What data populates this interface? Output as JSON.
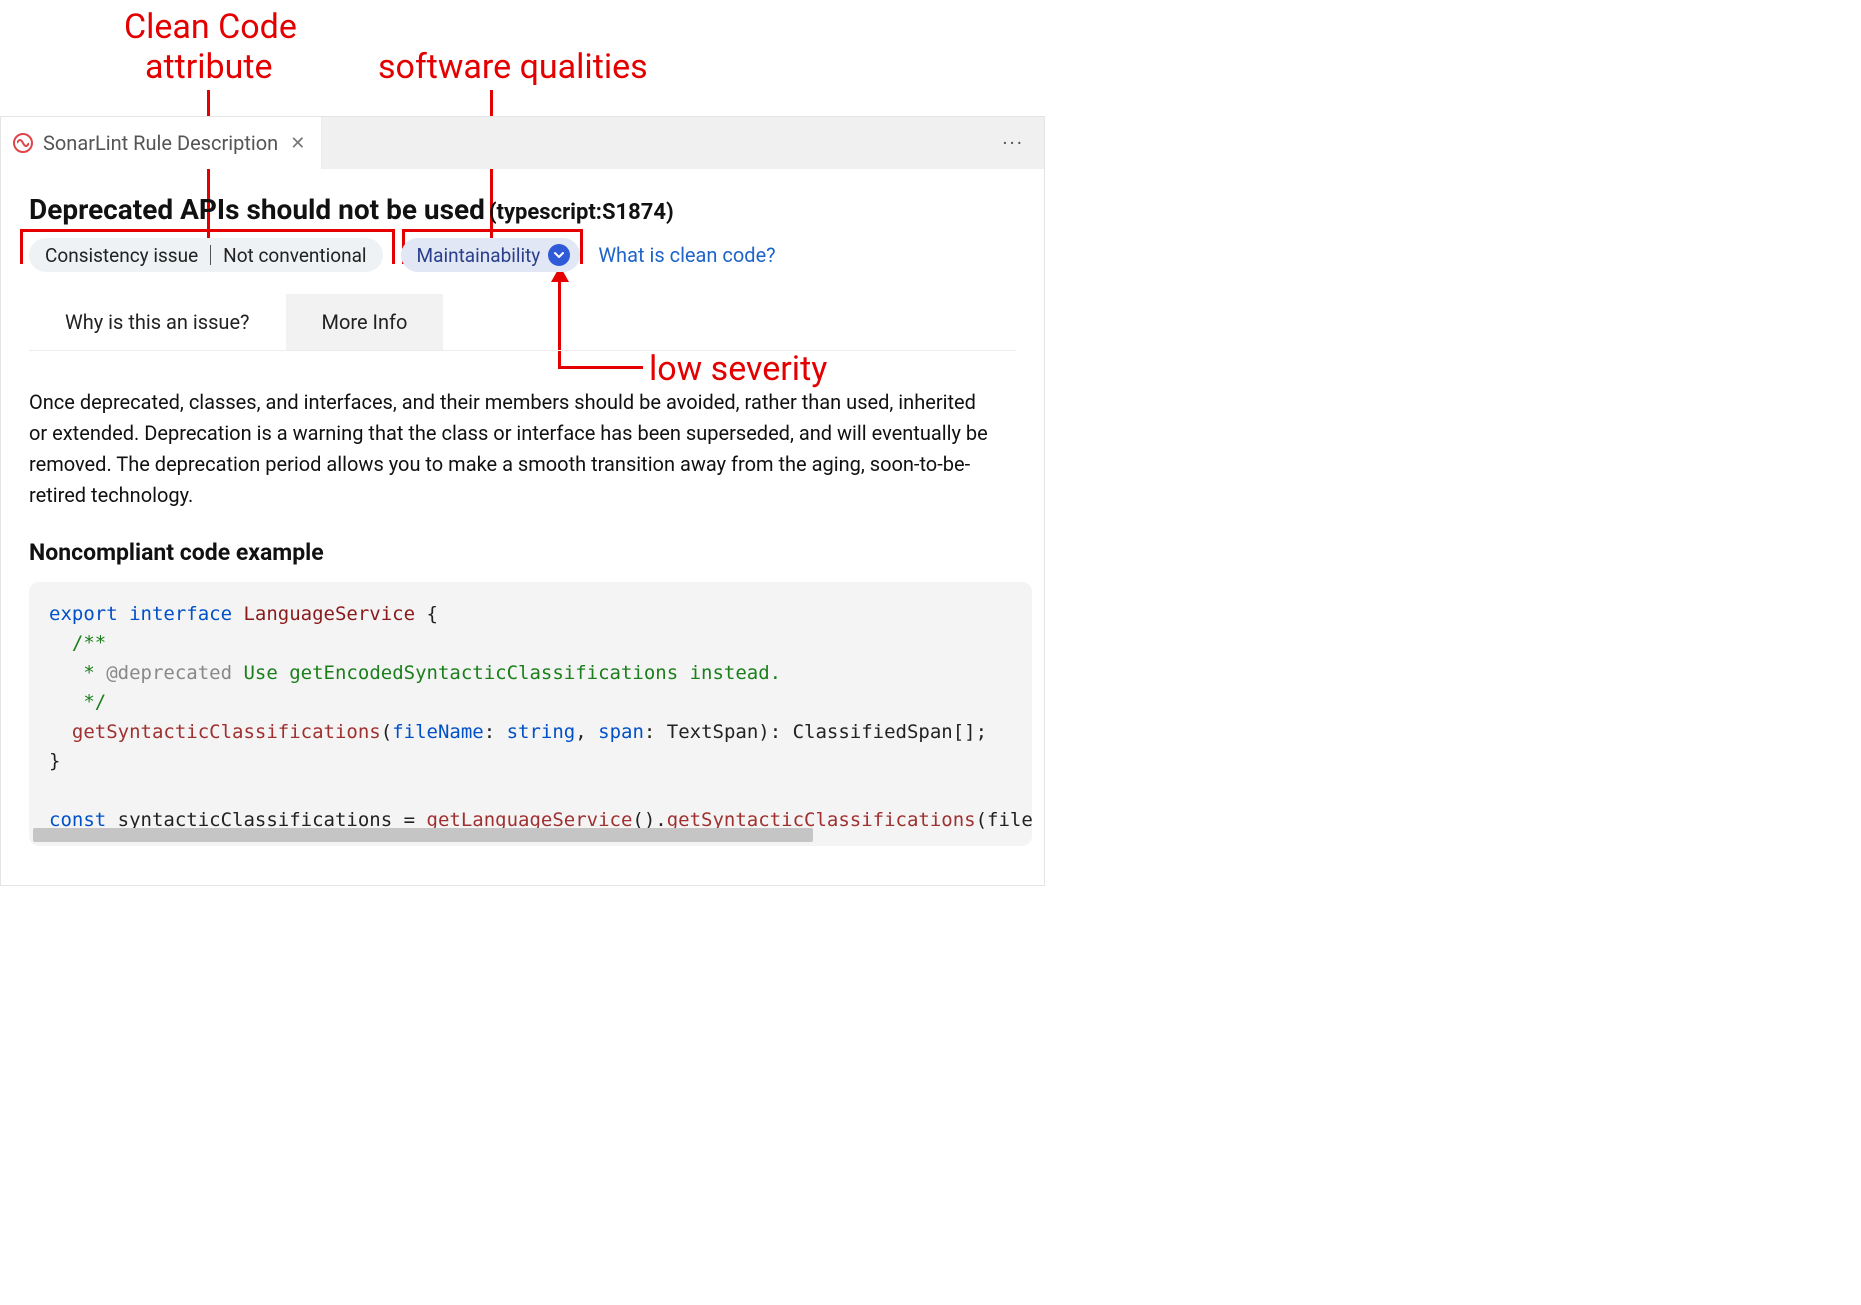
{
  "annotations": {
    "clean_code_attr_l1": "Clean Code",
    "clean_code_attr_l2": "attribute",
    "software_qualities": "software qualities",
    "low_severity": "low severity"
  },
  "tab": {
    "title": "SonarLint Rule Description",
    "icon": "sonarlint-icon",
    "close": "close-icon",
    "more": "more-actions"
  },
  "rule": {
    "title": "Deprecated APIs should not be used",
    "id": "(typescript:S1874)"
  },
  "chips": {
    "issue_type": "Consistency issue",
    "attribute": "Not conventional",
    "quality": "Maintainability",
    "severity_icon": "chevron-down-icon",
    "clean_code_link": "What is clean code?"
  },
  "subtabs": {
    "why": "Why is this an issue?",
    "more": "More Info"
  },
  "description": "Once deprecated, classes, and interfaces, and their members should be avoided, rather than used, inherited or extended. Deprecation is a warning that the class or interface has been superseded, and will eventually be removed. The deprecation period allows you to make a smooth transition away from the aging, soon-to-be-retired technology.",
  "section_heading": "Noncompliant code example",
  "code": {
    "l1_export": "export",
    "l1_interface": " interface",
    "l1_name": " LanguageService",
    "l1_brace": " {",
    "l2": "  /**",
    "l3a": "   * ",
    "l3b": "@deprecated ",
    "l3c": "Use getEncodedSyntacticClassifications instead.",
    "l4": "   */",
    "l5a": "  getSyntacticClassifications",
    "l5b": "(",
    "l5c": "fileName",
    "l5d": ": ",
    "l5e": "string",
    "l5f": ", ",
    "l5g": "span",
    "l5h": ": TextSpan): ClassifiedSpan[];",
    "l6": "}",
    "l8a": "const",
    "l8b": " syntacticClassifications = ",
    "l8c": "getLanguageService",
    "l8d": "().",
    "l8e": "getSyntacticClassifications",
    "l8f": "(file, sp"
  }
}
